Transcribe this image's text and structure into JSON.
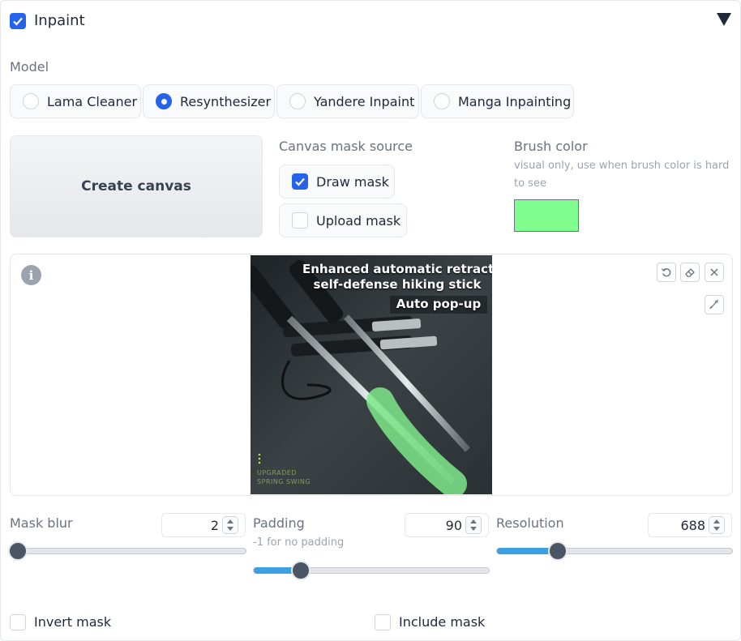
{
  "header": {
    "title": "Inpaint",
    "enabled": true
  },
  "model": {
    "label": "Model",
    "options": [
      "Lama Cleaner",
      "Resynthesizer",
      "Yandere Inpaint",
      "Manga Inpainting"
    ],
    "selected": "Resynthesizer"
  },
  "create_canvas_label": "Create canvas",
  "mask_source": {
    "label": "Canvas mask source",
    "draw_mask": {
      "label": "Draw mask",
      "checked": true
    },
    "upload_mask": {
      "label": "Upload mask",
      "checked": false
    }
  },
  "brush": {
    "label": "Brush color",
    "info": "visual only, use when brush color is hard to see",
    "color": "#80ff90"
  },
  "image": {
    "caption_line1": "Enhanced automatic retractable",
    "caption_line2": "self-defense hiking stick",
    "caption_line3": "Auto pop-up",
    "small_line1": "UPGRADED",
    "small_line2": "SPRING SWING",
    "mask_color": "#7ee88a"
  },
  "toolbar_icons": [
    "undo-icon",
    "eraser-icon",
    "close-icon",
    "brush-icon"
  ],
  "sliders": {
    "mask_blur": {
      "label": "Mask blur",
      "value": "2",
      "min": 0,
      "max": 64,
      "fraction": 0.03
    },
    "padding": {
      "label": "Padding",
      "info": "-1 for no padding",
      "value": "90",
      "fraction": 0.2
    },
    "resolution": {
      "label": "Resolution",
      "value": "688",
      "fraction": 0.26
    }
  },
  "invert_mask": {
    "label": "Invert mask",
    "checked": false
  },
  "include_mask": {
    "label": "Include mask",
    "checked": false
  },
  "colors": {
    "accent": "#2563eb",
    "slider_fill": "#3b9fe0"
  }
}
